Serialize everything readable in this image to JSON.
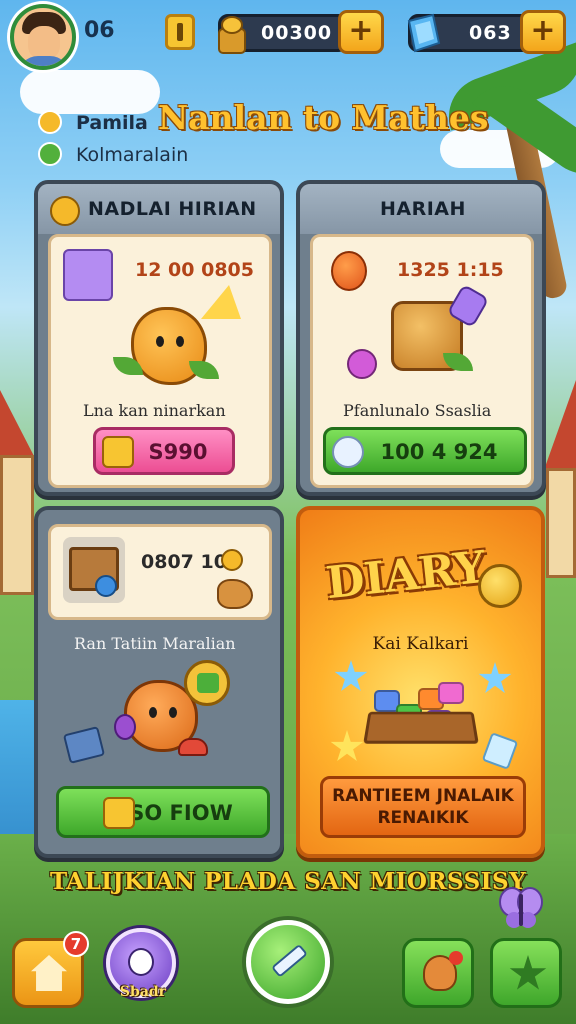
{
  "hud": {
    "level": "06",
    "coins": "00300",
    "gems": "063",
    "plus_label": "+"
  },
  "header": {
    "sub_name_1": "Pamila",
    "sub_name_2": "Kolmaralain",
    "title": "Nanlan to Mathes"
  },
  "cards": [
    {
      "title": "NADLAI HIRIAN",
      "timer": "12 00 0805",
      "item_caption": "Lna kan ninarkan",
      "button_label": "S990"
    },
    {
      "title": "HARIAH",
      "timer": "1325 1:15",
      "item_caption": "Pfanlunalo Ssaslia",
      "button_label": "100 4 924"
    },
    {
      "timer": "0807 10",
      "item_caption": "Ran Tatiin Maralian",
      "button_label": "SO FIOW"
    }
  ],
  "diary": {
    "title": "DIARY",
    "subtitle": "Kai Kalkari",
    "button_label": "RANTIEEM JNALAIK RENAIKIK"
  },
  "banner": "TALIJKIAN PLADA SAN MIORSSISY",
  "nav": {
    "home_badge": "7",
    "pet_label": "Sbadr"
  },
  "colors": {
    "accent_gold": "#ffc12e",
    "button_green": "#3ea82a",
    "button_pink": "#ec4e93",
    "diary_orange": "#f07d17"
  }
}
